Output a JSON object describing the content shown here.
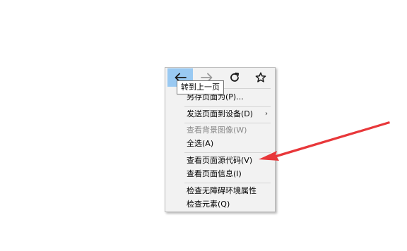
{
  "tooltip": {
    "text": "转到上一页"
  },
  "nav": {
    "back_icon": "arrow-left-icon",
    "forward_icon": "arrow-right-icon",
    "reload_icon": "reload-icon",
    "bookmark_icon": "star-icon"
  },
  "menu": {
    "items": [
      {
        "label": "另存页面为(P)...",
        "enabled": true
      },
      {
        "label": "发送页面到设备(D)",
        "enabled": true,
        "submenu_arrow": "›"
      },
      {
        "label": "查看背景图像(W)",
        "enabled": false
      },
      {
        "label": "全选(A)",
        "enabled": true
      },
      {
        "label": "查看页面源代码(V)",
        "enabled": true
      },
      {
        "label": "查看页面信息(I)",
        "enabled": true
      },
      {
        "label": "检查无障碍环境属性",
        "enabled": true
      },
      {
        "label": "检查元素(Q)",
        "enabled": true
      }
    ]
  },
  "colors": {
    "annotation_arrow": "#e8373a",
    "active_button": "#99c9f2"
  }
}
